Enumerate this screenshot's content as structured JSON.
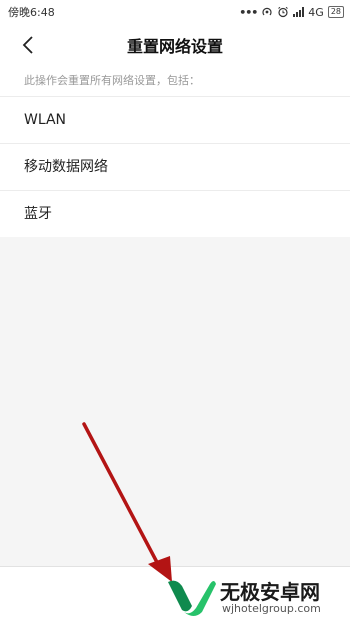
{
  "status_bar": {
    "time": "傍晚6:48",
    "network": "4G",
    "battery": "28",
    "icons": [
      "more-dots-icon",
      "hotspot-icon",
      "alarm-icon",
      "signal-icon",
      "battery-icon"
    ]
  },
  "header": {
    "back_icon": "chevron-left-icon",
    "title": "重置网络设置"
  },
  "main": {
    "description": "此操作会重置所有网络设置，包括：",
    "items": [
      {
        "label": "WLAN"
      },
      {
        "label": "移动数据网络"
      },
      {
        "label": "蓝牙"
      }
    ]
  },
  "annotation": {
    "arrow_color": "#b31414"
  },
  "watermark": {
    "title": "无极安卓网",
    "url": "wjhotelgroup.com",
    "logo_colors": [
      "#0f8a4e",
      "#27c26a"
    ]
  }
}
